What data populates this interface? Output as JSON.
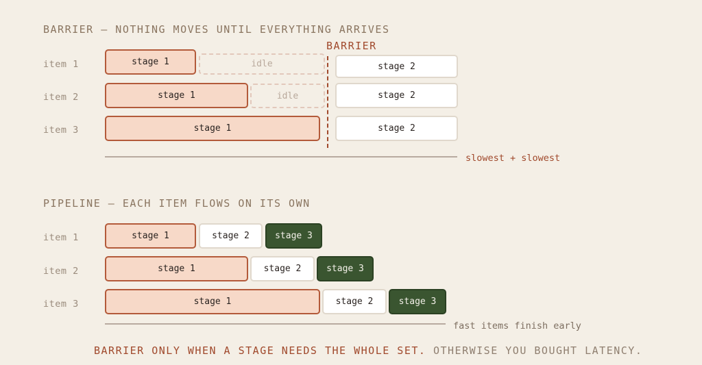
{
  "barrier_section": {
    "title": "BARRIER — NOTHING MOVES UNTIL EVERYTHING ARRIVES",
    "barrier_label": "BARRIER",
    "rows": [
      {
        "label": "item 1",
        "stage1": "stage 1",
        "idle": "idle",
        "stage2": "stage 2"
      },
      {
        "label": "item 2",
        "stage1": "stage 1",
        "idle": "idle",
        "stage2": "stage 2"
      },
      {
        "label": "item 3",
        "stage1": "stage 1",
        "stage2": "stage 2"
      }
    ],
    "axis_label": "slowest + slowest",
    "axis_label_color": "#a0492c"
  },
  "pipeline_section": {
    "title": "PIPELINE — EACH ITEM FLOWS ON ITS OWN",
    "rows": [
      {
        "label": "item 1",
        "stage1": "stage 1",
        "stage2": "stage 2",
        "stage3": "stage 3"
      },
      {
        "label": "item 2",
        "stage1": "stage 1",
        "stage2": "stage 2",
        "stage3": "stage 3"
      },
      {
        "label": "item 3",
        "stage1": "stage 1",
        "stage2": "stage 2",
        "stage3": "stage 3"
      }
    ],
    "axis_label": "fast items finish early",
    "axis_label_color": "#7d6e60"
  },
  "footer": {
    "emphasis": "BARRIER ONLY WHEN A STAGE NEEDS THE WHOLE SET.",
    "rest": "OTHERWISE YOU BOUGHT LATENCY."
  },
  "colors": {
    "background": "#f4efe6",
    "stage1_fill": "#f7d9c8",
    "stage1_border": "#b35a3a",
    "stage2_fill": "#ffffff",
    "stage3_fill": "#3a5530",
    "accent": "#a0492c"
  }
}
